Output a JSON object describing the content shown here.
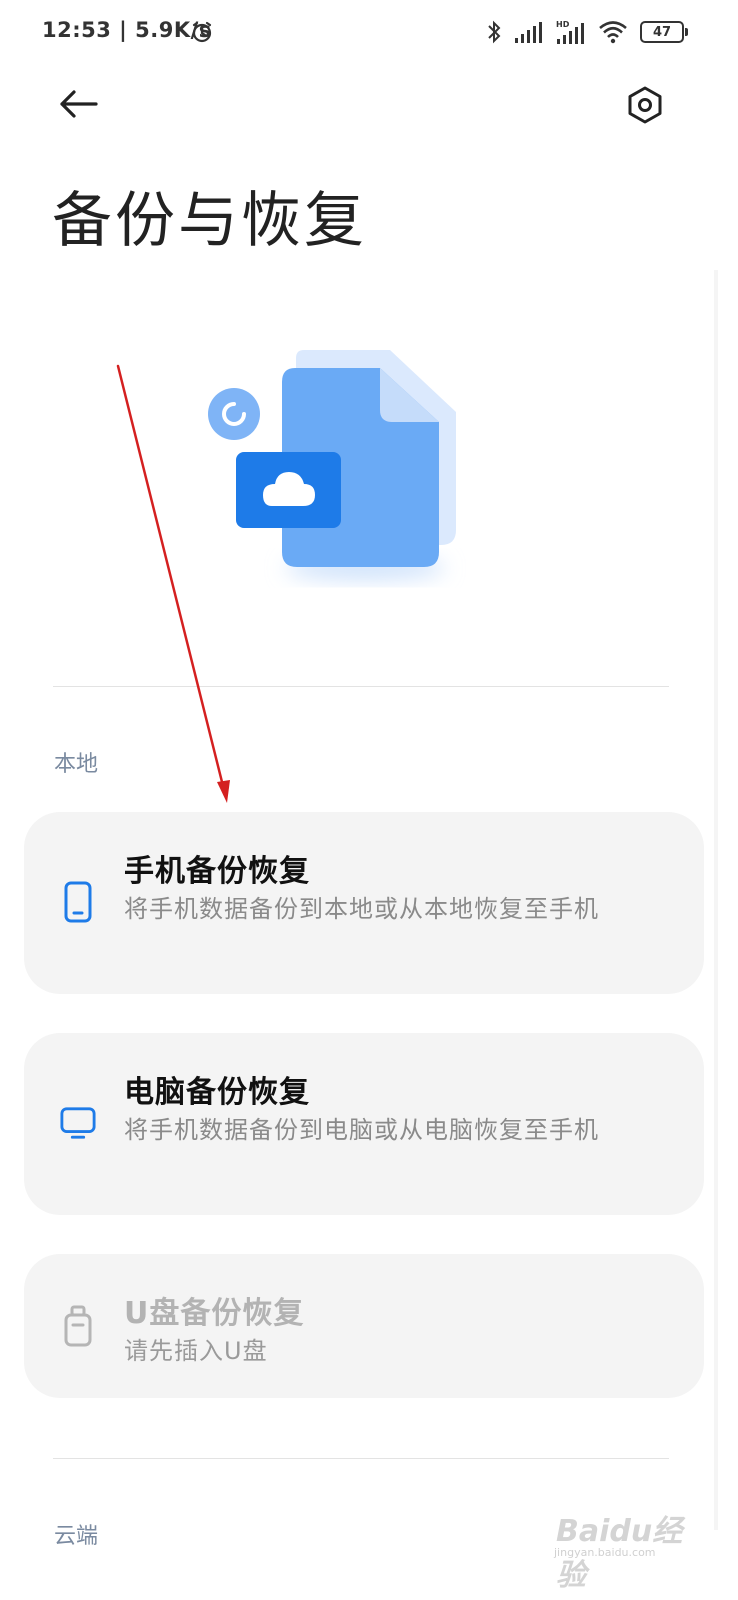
{
  "status_bar": {
    "time": "12:53 | 5.9K/s",
    "battery": "47",
    "icons": [
      "alarm-icon",
      "bluetooth-icon",
      "signal-icon",
      "hd-signal-icon",
      "wifi-icon",
      "battery-icon"
    ]
  },
  "header": {
    "back_icon": "back-arrow-icon",
    "settings_icon": "settings-icon",
    "title": "备份与恢复"
  },
  "sections": [
    {
      "label": "本地",
      "cards": [
        {
          "title": "手机备份恢复",
          "desc": "将手机数据备份到本地或从本地恢复至手机",
          "icon": "phone-icon",
          "enabled": true
        },
        {
          "title": "电脑备份恢复",
          "desc": "将手机数据备份到电脑或从电脑恢复至手机",
          "icon": "computer-icon",
          "enabled": true
        },
        {
          "title": "U盘备份恢复",
          "desc": "请先插入U盘",
          "icon": "usb-drive-icon",
          "enabled": false
        }
      ]
    },
    {
      "label": "云端"
    }
  ],
  "watermark": {
    "text": "Baidu经验",
    "sub": "jingyan.baidu.com"
  },
  "colors": {
    "accent": "#1e7be8",
    "hero_blue": "#6aaaf5",
    "annotation": "#d42020"
  }
}
